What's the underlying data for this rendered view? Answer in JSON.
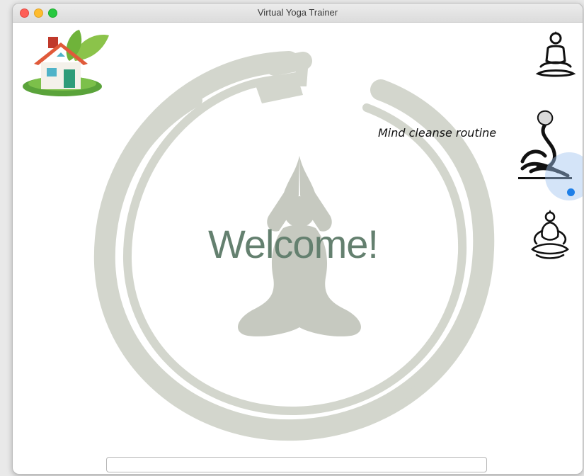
{
  "window": {
    "title": "Virtual Yoga Trainer"
  },
  "main": {
    "welcome_text": "Welcome!"
  },
  "sidebar": {
    "items": [
      {
        "name": "meditation-pose",
        "icon": "meditation-icon"
      },
      {
        "name": "mind-cleanse-pose",
        "icon": "reclining-pose-icon"
      },
      {
        "name": "lotus-pose",
        "icon": "lotus-icon"
      }
    ],
    "tooltip": "Mind cleanse routine"
  },
  "input": {
    "value": "",
    "placeholder": ""
  },
  "colors": {
    "enso": "#d3d6cd",
    "welcome": "#64806f",
    "accent": "#1e7fe8"
  }
}
